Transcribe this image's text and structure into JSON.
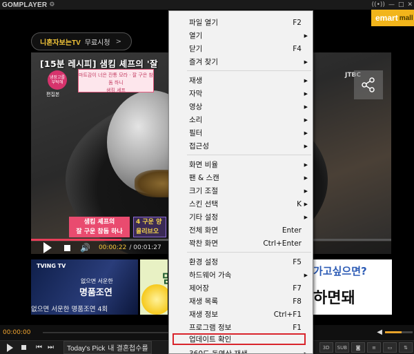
{
  "app": {
    "title": "GOMPLAYER"
  },
  "ad_top": {
    "brand": "니혼자보는TV",
    "label": "무료시청",
    "arrow": ">"
  },
  "emart": {
    "label": "emart",
    "suffix": "mall"
  },
  "video": {
    "title": "[15분 레시피] 샘킴 셰프의 '잘",
    "caption_line1": "마트감이 너은 잔통 모라 · 잘 구은 참돔 하니",
    "caption_line2": "샘킴 셰프",
    "logo_text": "냉장고를 부탁해",
    "logo_label": "편집본",
    "jtbc": "JTBC",
    "sub1_line1": "샘킴 셰프의",
    "sub1_line2": "잘 구운 참돔 하나",
    "sub2_line1": "4 구운 양",
    "sub2_line2": "올리브오",
    "time_current": "00:00:22",
    "time_total": "/ 00:01:27",
    "progress": 0.25
  },
  "banners": {
    "tving_brand": "TVING TV",
    "tving_line1": "없으면 서운한",
    "tving_line2": "명품조연",
    "caption": "없으면 서운한 명품조연 4회",
    "b2_text": "맘",
    "b3_line1": "가고싶으면?",
    "b3_line2": "하면돼"
  },
  "timeline": {
    "time": "00:00:00",
    "volume": 0.6
  },
  "toolbar": {
    "pick_label": "Today's Pick",
    "pick_text": "내 결혼첩수를",
    "chips": [
      "3D",
      "SUB",
      "◙",
      "≡",
      "▭",
      "⇅"
    ]
  },
  "menu": {
    "items": [
      {
        "label": "파일 열기",
        "shortcut": "F2",
        "submenu": false
      },
      {
        "label": "열기",
        "shortcut": "",
        "submenu": true
      },
      {
        "label": "닫기",
        "shortcut": "F4",
        "submenu": false
      },
      {
        "label": "즐겨 찾기",
        "shortcut": "",
        "submenu": true
      },
      {
        "label": "재생",
        "shortcut": "",
        "submenu": true
      },
      {
        "label": "자막",
        "shortcut": "",
        "submenu": true
      },
      {
        "label": "영상",
        "shortcut": "",
        "submenu": true
      },
      {
        "label": "소리",
        "shortcut": "",
        "submenu": true
      },
      {
        "label": "필터",
        "shortcut": "",
        "submenu": true
      },
      {
        "label": "접근성",
        "shortcut": "",
        "submenu": true
      },
      {
        "label": "화면 비율",
        "shortcut": "",
        "submenu": true
      },
      {
        "label": "팬 & 스캔",
        "shortcut": "",
        "submenu": true
      },
      {
        "label": "크기 조절",
        "shortcut": "",
        "submenu": true
      },
      {
        "label": "스킨 선택",
        "shortcut": "K",
        "submenu": true
      },
      {
        "label": "기타 설정",
        "shortcut": "",
        "submenu": true
      },
      {
        "label": "전체 화면",
        "shortcut": "Enter",
        "submenu": false
      },
      {
        "label": "꽉찬 화면",
        "shortcut": "Ctrl+Enter",
        "submenu": false
      },
      {
        "label": "환경 설정",
        "shortcut": "F5",
        "submenu": false
      },
      {
        "label": "하드웨어 가속",
        "shortcut": "",
        "submenu": true
      },
      {
        "label": "제어장",
        "shortcut": "F7",
        "submenu": false
      },
      {
        "label": "재생 목록",
        "shortcut": "F8",
        "submenu": false
      },
      {
        "label": "재생 정보",
        "shortcut": "Ctrl+F1",
        "submenu": false
      },
      {
        "label": "프로그램 정보",
        "shortcut": "F1",
        "submenu": false
      },
      {
        "label": "업데이트 확인",
        "shortcut": "",
        "submenu": false
      },
      {
        "label": "360도 동영상 재생",
        "shortcut": "",
        "submenu": true
      }
    ]
  }
}
